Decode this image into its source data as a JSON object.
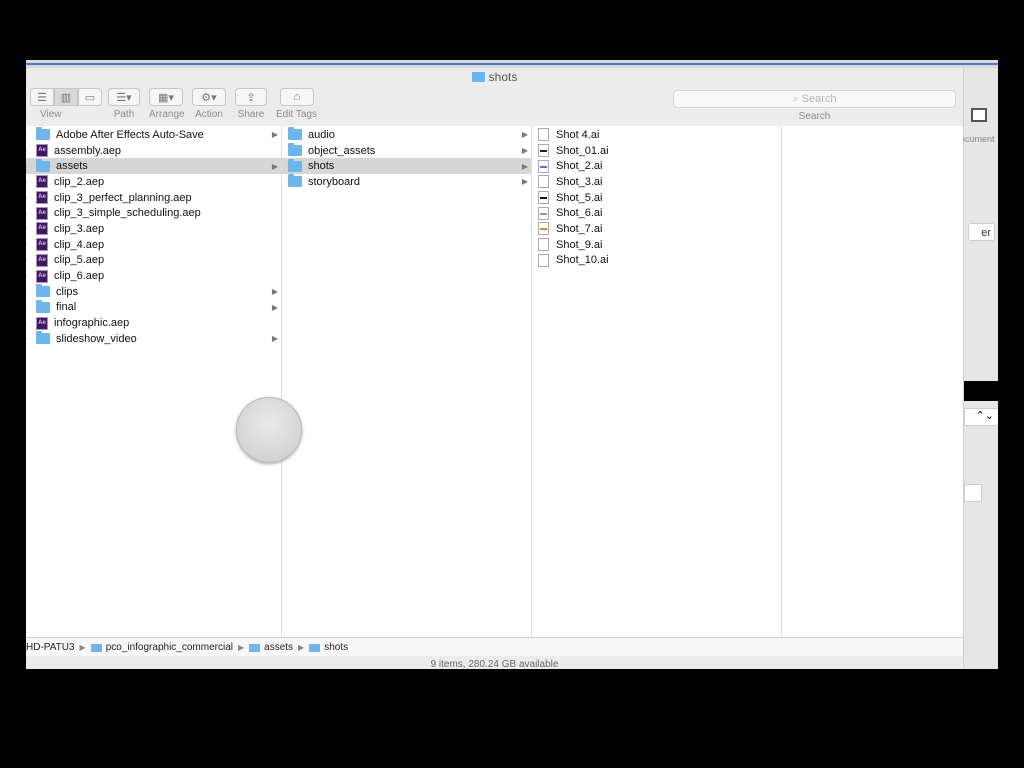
{
  "window": {
    "title": "shots"
  },
  "toolbar": {
    "view_label": "View",
    "path_label": "Path",
    "arrange_label": "Arrange",
    "action_label": "Action",
    "share_label": "Share",
    "edit_tags_label": "Edit Tags",
    "search_placeholder": "Search",
    "search_label": "Search"
  },
  "columns": {
    "col1": [
      {
        "name": "Adobe After Effects Auto-Save",
        "icon": "folder-icon",
        "arrow": true
      },
      {
        "name": "assembly.aep",
        "icon": "ae-file-icon"
      },
      {
        "name": "assets",
        "icon": "folder-icon",
        "arrow": true,
        "selected": true
      },
      {
        "name": "clip_2.aep",
        "icon": "ae-file-icon"
      },
      {
        "name": "clip_3_perfect_planning.aep",
        "icon": "ae-file-icon"
      },
      {
        "name": "clip_3_simple_scheduling.aep",
        "icon": "ae-file-icon"
      },
      {
        "name": "clip_3.aep",
        "icon": "ae-file-icon"
      },
      {
        "name": "clip_4.aep",
        "icon": "ae-file-icon"
      },
      {
        "name": "clip_5.aep",
        "icon": "ae-file-icon"
      },
      {
        "name": "clip_6.aep",
        "icon": "ae-file-icon"
      },
      {
        "name": "clips",
        "icon": "folder-icon",
        "arrow": true
      },
      {
        "name": "final",
        "icon": "folder-icon",
        "arrow": true
      },
      {
        "name": "infographic.aep",
        "icon": "ae-file-icon"
      },
      {
        "name": "slideshow_video",
        "icon": "folder-icon",
        "arrow": true
      }
    ],
    "col2": [
      {
        "name": "audio",
        "icon": "folder-icon",
        "arrow": true
      },
      {
        "name": "object_assets",
        "icon": "folder-icon",
        "arrow": true
      },
      {
        "name": "shots",
        "icon": "folder-icon",
        "arrow": true,
        "selected": true
      },
      {
        "name": "storyboard",
        "icon": "folder-icon",
        "arrow": true
      }
    ],
    "col3": [
      {
        "name": "Shot 4.ai",
        "icon": "ai-file-icon",
        "thumb": "#ffffff"
      },
      {
        "name": "Shot_01.ai",
        "icon": "ai-file-icon",
        "thumb": "#222222"
      },
      {
        "name": "Shot_2.ai",
        "icon": "ai-file-icon",
        "thumb": "#4a7ac8"
      },
      {
        "name": "Shot_3.ai",
        "icon": "ai-file-icon",
        "thumb": "#ffffff"
      },
      {
        "name": "Shot_5.ai",
        "icon": "ai-file-icon",
        "thumb": "#111111"
      },
      {
        "name": "Shot_6.ai",
        "icon": "ai-file-icon",
        "thumb": "#7fa0a8"
      },
      {
        "name": "Shot_7.ai",
        "icon": "ai-file-icon",
        "thumb": "#e08a2a"
      },
      {
        "name": "Shot_9.ai",
        "icon": "ai-file-icon",
        "thumb": "#ffffff"
      },
      {
        "name": "Shot_10.ai",
        "icon": "ai-file-icon",
        "thumb": "#ffffff"
      }
    ]
  },
  "path": [
    "HD-PATU3",
    "pco_infographic_commercial",
    "assets",
    "shots"
  ],
  "status": "9 items, 280.24 GB available",
  "background_app": {
    "doc_label": "ocument",
    "button_label": "er",
    "stepper_glyph": "⌃⌄"
  },
  "colors": {
    "folder": "#6cb6ec",
    "selection": "#d6d6d6",
    "accent": "#4a7ac8"
  }
}
